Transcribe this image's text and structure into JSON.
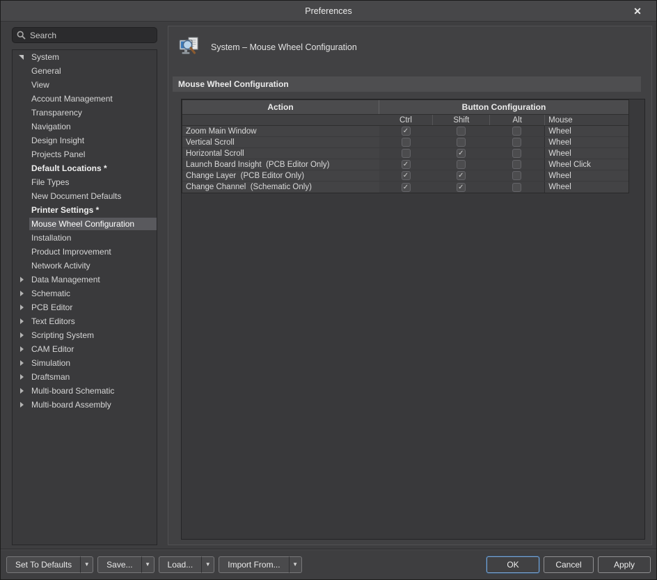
{
  "window": {
    "title": "Preferences"
  },
  "icons": {
    "close_glyph": "✕",
    "check_glyph": "✓",
    "dropdown_glyph": "▼",
    "search_icon": "magnifier",
    "header_icon": "system-monitor-magnifier"
  },
  "colors": {
    "dialog_bg": "#3e3e40",
    "titlebar_bg": "#474749",
    "selected_item_bg": "#59595d",
    "section_bar_bg": "#4e4e50",
    "screen_blue": "#3b79b8",
    "ok_focus_border": "#7ba7d7"
  },
  "sidebar": {
    "search_placeholder": "Search",
    "tree": [
      {
        "label": "System",
        "level": 0,
        "state": "expanded",
        "bold": false,
        "selected": false
      },
      {
        "label": "General",
        "level": 1
      },
      {
        "label": "View",
        "level": 1
      },
      {
        "label": "Account Management",
        "level": 1
      },
      {
        "label": "Transparency",
        "level": 1
      },
      {
        "label": "Navigation",
        "level": 1
      },
      {
        "label": "Design Insight",
        "level": 1
      },
      {
        "label": "Projects Panel",
        "level": 1
      },
      {
        "label": "Default Locations *",
        "level": 1,
        "bold": true
      },
      {
        "label": "File Types",
        "level": 1
      },
      {
        "label": "New Document Defaults",
        "level": 1
      },
      {
        "label": "Printer Settings *",
        "level": 1,
        "bold": true
      },
      {
        "label": "Mouse Wheel Configuration",
        "level": 1,
        "selected": true
      },
      {
        "label": "Installation",
        "level": 1
      },
      {
        "label": "Product Improvement",
        "level": 1
      },
      {
        "label": "Network Activity",
        "level": 1
      },
      {
        "label": "Data Management",
        "level": 0,
        "state": "collapsed"
      },
      {
        "label": "Schematic",
        "level": 0,
        "state": "collapsed"
      },
      {
        "label": "PCB Editor",
        "level": 0,
        "state": "collapsed"
      },
      {
        "label": "Text Editors",
        "level": 0,
        "state": "collapsed"
      },
      {
        "label": "Scripting System",
        "level": 0,
        "state": "collapsed"
      },
      {
        "label": "CAM Editor",
        "level": 0,
        "state": "collapsed"
      },
      {
        "label": "Simulation",
        "level": 0,
        "state": "collapsed"
      },
      {
        "label": "Draftsman",
        "level": 0,
        "state": "collapsed"
      },
      {
        "label": "Multi-board Schematic",
        "level": 0,
        "state": "collapsed"
      },
      {
        "label": "Multi-board Assembly",
        "level": 0,
        "state": "collapsed"
      }
    ]
  },
  "main": {
    "header_title": "System – Mouse Wheel Configuration",
    "section_title": "Mouse Wheel Configuration",
    "table": {
      "col_action": "Action",
      "col_button_config": "Button Configuration",
      "sub_ctrl": "Ctrl",
      "sub_shift": "Shift",
      "sub_alt": "Alt",
      "sub_mouse": "Mouse",
      "rows": [
        {
          "action": "Zoom Main Window",
          "ctrl": true,
          "shift": false,
          "alt": false,
          "mouse": "Wheel"
        },
        {
          "action": "Vertical Scroll",
          "ctrl": false,
          "shift": false,
          "alt": false,
          "mouse": "Wheel"
        },
        {
          "action": "Horizontal Scroll",
          "ctrl": false,
          "shift": true,
          "alt": false,
          "mouse": "Wheel"
        },
        {
          "action": "Launch Board Insight  (PCB Editor Only)",
          "ctrl": true,
          "shift": false,
          "alt": false,
          "mouse": "Wheel Click"
        },
        {
          "action": "Change Layer  (PCB Editor Only)",
          "ctrl": true,
          "shift": true,
          "alt": false,
          "mouse": "Wheel"
        },
        {
          "action": "Change Channel  (Schematic Only)",
          "ctrl": true,
          "shift": true,
          "alt": false,
          "mouse": "Wheel"
        }
      ]
    }
  },
  "footer": {
    "set_to_defaults": "Set To Defaults",
    "save": "Save...",
    "load": "Load...",
    "import_from": "Import From...",
    "ok": "OK",
    "cancel": "Cancel",
    "apply": "Apply"
  }
}
